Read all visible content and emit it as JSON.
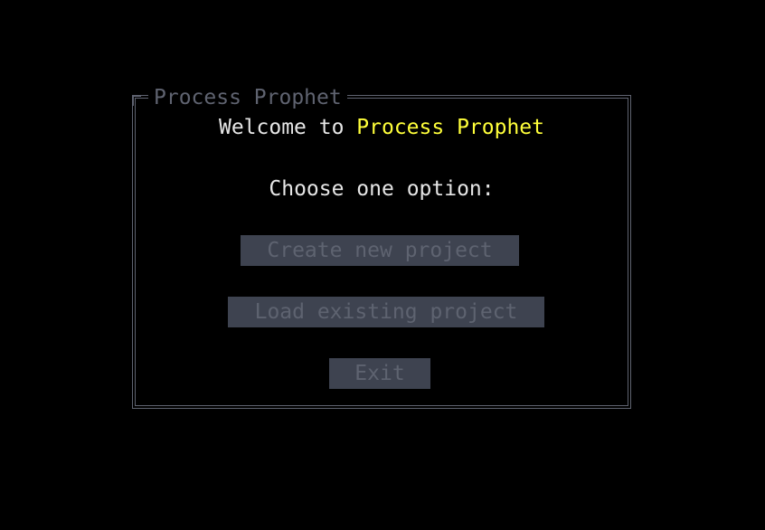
{
  "window": {
    "frame_title": "Process Prophet"
  },
  "welcome": {
    "prefix": "Welcome to ",
    "app_name": "Process Prophet"
  },
  "prompt": "Choose one option:",
  "buttons": {
    "create": "Create new project",
    "load": "Load existing project",
    "exit": "Exit"
  },
  "colors": {
    "background": "#000000",
    "text": "#e6e6e6",
    "accent": "#ffff3a",
    "frame": "#5f6370",
    "button_bg": "#3e4350",
    "button_text": "#5e6370"
  }
}
